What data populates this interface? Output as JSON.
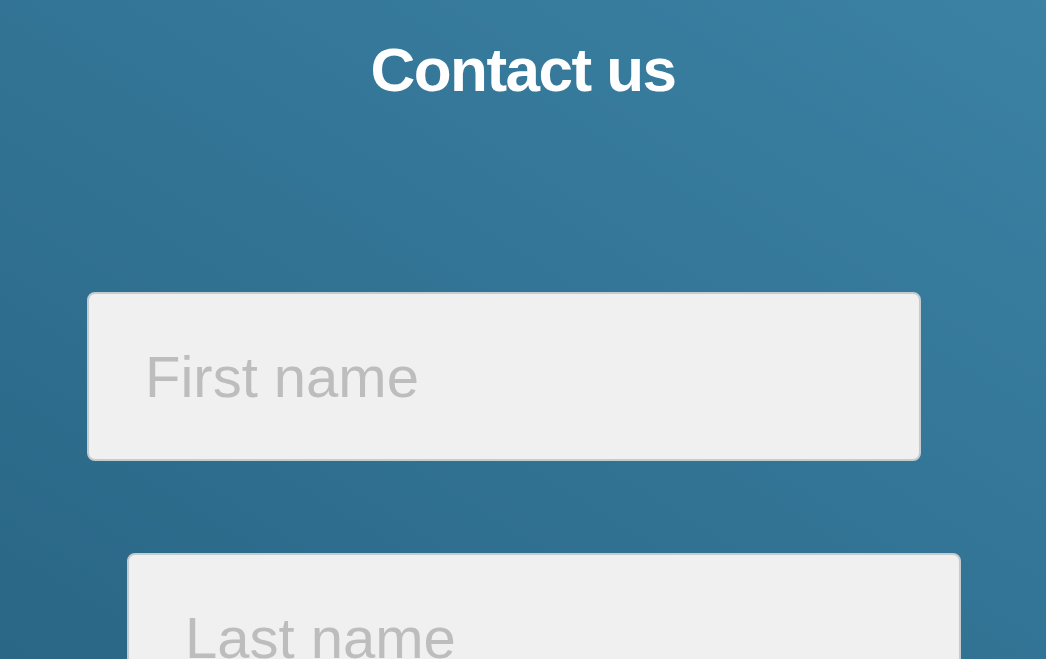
{
  "title": "Contact us",
  "fields": [
    {
      "placeholder": "First name"
    },
    {
      "placeholder": "Last name"
    }
  ]
}
